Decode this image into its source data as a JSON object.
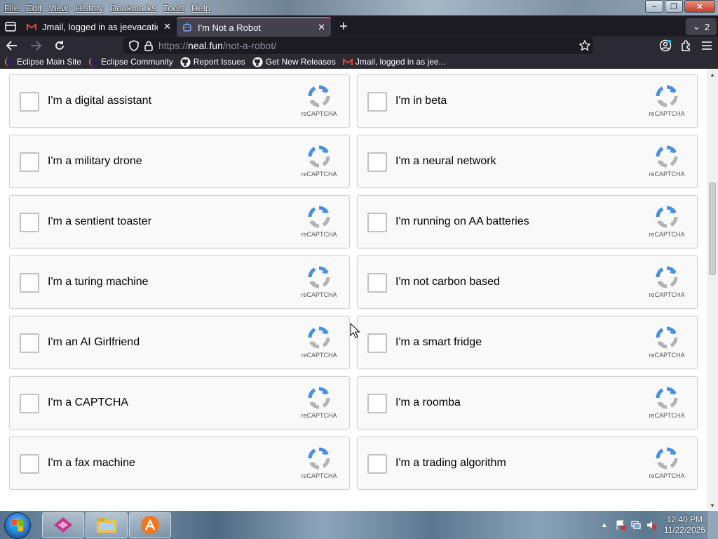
{
  "menubar": {
    "items": [
      "File",
      "Edit",
      "View",
      "History",
      "Bookmarks",
      "Tools",
      "Help"
    ]
  },
  "window_controls": {
    "minimize": "–",
    "maximize": "❐",
    "close": "✕"
  },
  "tabs": [
    {
      "title": "Jmail, logged in as jeevacation@",
      "icon": "gmail-m-icon",
      "active": false
    },
    {
      "title": "I'm Not a Robot",
      "icon": "robot-icon",
      "active": true
    }
  ],
  "tab_count": "2",
  "address_bar": {
    "scheme": "https://",
    "host": "neal.fun",
    "path": "/not-a-robot/"
  },
  "bookmarks": [
    {
      "label": "Eclipse Main Site",
      "icon": "eclipse-icon"
    },
    {
      "label": "Eclipse Community",
      "icon": "eclipse-icon"
    },
    {
      "label": "Report Issues",
      "icon": "github-icon"
    },
    {
      "label": "Get New Releases",
      "icon": "github-icon"
    },
    {
      "label": "Jmail, logged in as jee...",
      "icon": "gmail-m-icon"
    }
  ],
  "captcha_brand": "reCAPTCHA",
  "captchas": [
    {
      "label": "I'm a digital assistant",
      "checked": false
    },
    {
      "label": "I'm in beta",
      "checked": false
    },
    {
      "label": "I'm a military drone",
      "checked": false
    },
    {
      "label": "I'm a neural network",
      "checked": false
    },
    {
      "label": "I'm a sentient toaster",
      "checked": false
    },
    {
      "label": "I'm running on AA batteries",
      "checked": false
    },
    {
      "label": "I'm a turing machine",
      "checked": false
    },
    {
      "label": "I'm not carbon based",
      "checked": false
    },
    {
      "label": "I'm an AI Girlfriend",
      "checked": false
    },
    {
      "label": "I'm a smart fridge",
      "checked": false
    },
    {
      "label": "I'm a CAPTCHA",
      "checked": false
    },
    {
      "label": "I'm a roomba",
      "checked": false
    },
    {
      "label": "I'm a fax machine",
      "checked": false
    },
    {
      "label": "I'm a trading algorithm",
      "checked": false
    }
  ],
  "taskbar": {
    "time": "12:40 PM",
    "date": "11/22/2025",
    "apps": [
      "eclipse-app-icon",
      "file-explorer-icon",
      "avast-icon"
    ]
  },
  "colors": {
    "active_tab_accent": "#e24a8d",
    "recaptcha_blue": "#4a90e2",
    "recaptcha_gray": "#b3b3b3"
  }
}
